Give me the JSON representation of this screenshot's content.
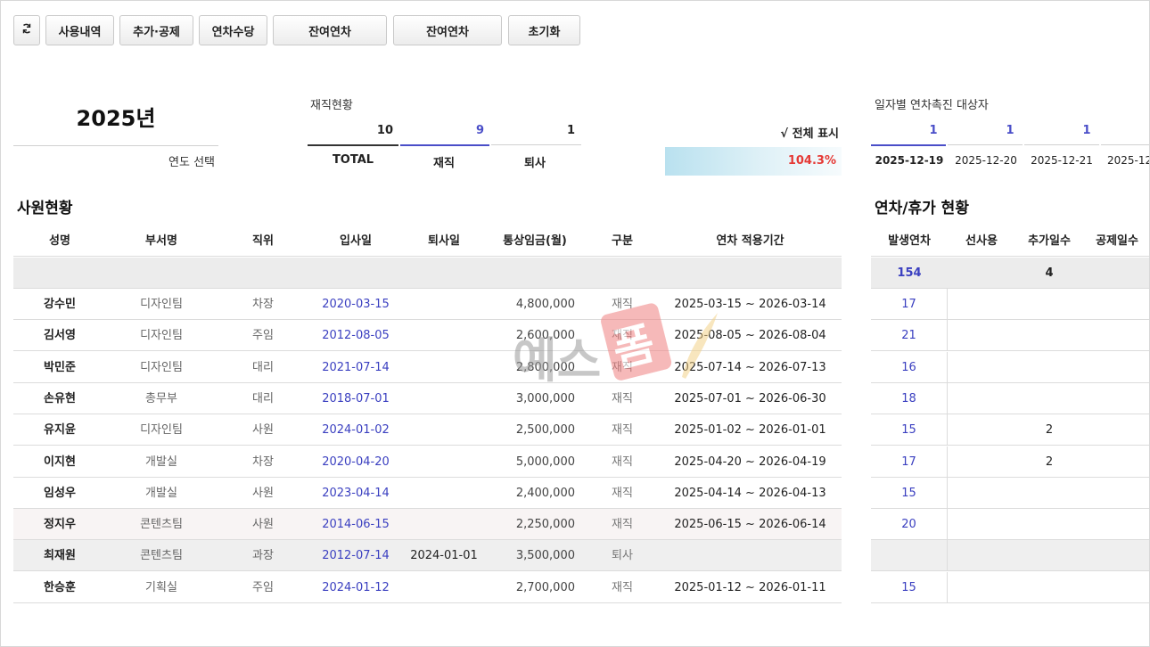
{
  "toolbar": {
    "refresh_icon": "refresh-icon",
    "buttons": [
      "사용내역",
      "추가·공제",
      "연차수당",
      "잔여연차",
      "잔여연차",
      "초기화"
    ]
  },
  "year": {
    "value": "2025년",
    "select_label": "연도 선택"
  },
  "employment": {
    "title": "재직현황",
    "total": "10",
    "active": "9",
    "retired": "1",
    "total_label": "TOTAL",
    "active_label": "재직",
    "retired_label": "퇴사",
    "show_all": "√ 전체 표시",
    "percent": "104.3%",
    "active_color": "#4a4ec8",
    "percent_color": "#e53935"
  },
  "promo": {
    "title": "일자별 연차촉진 대상자",
    "counts": [
      "1",
      "1",
      "1",
      ""
    ],
    "dates": [
      "2025-12-19",
      "2025-12-20",
      "2025-12-21",
      "2025-12"
    ]
  },
  "employees": {
    "title": "사원현황",
    "headers": [
      "성명",
      "부서명",
      "직위",
      "입사일",
      "퇴사일",
      "통상임금(월)",
      "구분",
      "연차 적용기간"
    ],
    "rows": [
      {
        "name": "강수민",
        "dept": "디자인팀",
        "rank": "차장",
        "join": "2020-03-15",
        "leave": "",
        "wage": "4,800,000",
        "type": "재직",
        "period": "2025-03-15 ~ 2026-03-14"
      },
      {
        "name": "김서영",
        "dept": "디자인팀",
        "rank": "주임",
        "join": "2012-08-05",
        "leave": "",
        "wage": "2,600,000",
        "type": "재직",
        "period": "2025-08-05 ~ 2026-08-04"
      },
      {
        "name": "박민준",
        "dept": "디자인팀",
        "rank": "대리",
        "join": "2021-07-14",
        "leave": "",
        "wage": "2,800,000",
        "type": "재직",
        "period": "2025-07-14 ~ 2026-07-13"
      },
      {
        "name": "손유현",
        "dept": "총무부",
        "rank": "대리",
        "join": "2018-07-01",
        "leave": "",
        "wage": "3,000,000",
        "type": "재직",
        "period": "2025-07-01 ~ 2026-06-30"
      },
      {
        "name": "유지윤",
        "dept": "디자인팀",
        "rank": "사원",
        "join": "2024-01-02",
        "leave": "",
        "wage": "2,500,000",
        "type": "재직",
        "period": "2025-01-02 ~ 2026-01-01"
      },
      {
        "name": "이지현",
        "dept": "개발실",
        "rank": "차장",
        "join": "2020-04-20",
        "leave": "",
        "wage": "5,000,000",
        "type": "재직",
        "period": "2025-04-20 ~ 2026-04-19"
      },
      {
        "name": "임성우",
        "dept": "개발실",
        "rank": "사원",
        "join": "2023-04-14",
        "leave": "",
        "wage": "2,400,000",
        "type": "재직",
        "period": "2025-04-14 ~ 2026-04-13"
      },
      {
        "name": "정지우",
        "dept": "콘텐츠팀",
        "rank": "사원",
        "join": "2014-06-15",
        "leave": "",
        "wage": "2,250,000",
        "type": "재직",
        "period": "2025-06-15 ~ 2026-06-14"
      },
      {
        "name": "최재원",
        "dept": "콘텐츠팀",
        "rank": "과장",
        "join": "2012-07-14",
        "leave": "2024-01-01",
        "wage": "3,500,000",
        "type": "퇴사",
        "period": ""
      },
      {
        "name": "한승훈",
        "dept": "기획실",
        "rank": "주임",
        "join": "2024-01-12",
        "leave": "",
        "wage": "2,700,000",
        "type": "재직",
        "period": "2025-01-12 ~ 2026-01-11"
      }
    ]
  },
  "leave": {
    "title": "연차/휴가 현황",
    "headers": [
      "발생연차",
      "선사용",
      "추가일수",
      "공제일수"
    ],
    "summary": {
      "occur": "154",
      "pre": "",
      "add": "4",
      "deduct": ""
    },
    "rows": [
      {
        "occur": "17",
        "pre": "",
        "add": "",
        "deduct": ""
      },
      {
        "occur": "21",
        "pre": "",
        "add": "",
        "deduct": ""
      },
      {
        "occur": "16",
        "pre": "",
        "add": "",
        "deduct": ""
      },
      {
        "occur": "18",
        "pre": "",
        "add": "",
        "deduct": ""
      },
      {
        "occur": "15",
        "pre": "",
        "add": "2",
        "deduct": ""
      },
      {
        "occur": "17",
        "pre": "",
        "add": "2",
        "deduct": ""
      },
      {
        "occur": "15",
        "pre": "",
        "add": "",
        "deduct": ""
      },
      {
        "occur": "20",
        "pre": "",
        "add": "",
        "deduct": ""
      },
      {
        "occur": "",
        "pre": "",
        "add": "",
        "deduct": ""
      },
      {
        "occur": "15",
        "pre": "",
        "add": "",
        "deduct": ""
      }
    ]
  },
  "watermark": {
    "text": "예스폼"
  }
}
